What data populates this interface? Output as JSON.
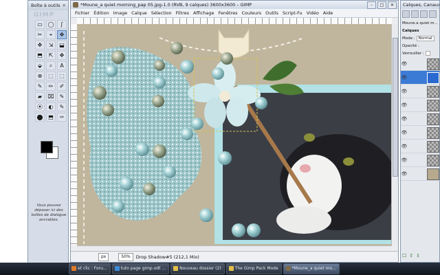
{
  "toolbox": {
    "title": "Boîte à outils",
    "close": "✕",
    "logo": "GIMP",
    "tools": [
      "▭",
      "◯",
      "ʃ",
      "✂",
      "⌖",
      "✥",
      "✥",
      "⇲",
      "⬓",
      "⬒",
      "⇱",
      "✥",
      "⬙",
      "⌕",
      "A",
      "⊕",
      "⬚",
      "⬚",
      "✎",
      "✏",
      "✐",
      "▰",
      "⌧",
      "✎",
      "⦿",
      "◐",
      "✎",
      "⬤",
      "⬒",
      "✑"
    ],
    "fg_color": "#000000",
    "bg_color": "#ffffff",
    "drop_hint": "Vous pouvez déposer ici des boîtes de dialogue ancrables."
  },
  "image_window": {
    "title": "*Moune_a quiet morning_pap 05.jpg-1.0 (RVB, 9 calques) 3600x3600 – GIMP",
    "menus": [
      "Fichier",
      "Édition",
      "Image",
      "Calque",
      "Sélection",
      "Filtres",
      "Affichage",
      "Fenêtres",
      "Couleurs",
      "Outils",
      "Script-Fu",
      "Vidéo",
      "Aide"
    ],
    "unit": "px",
    "zoom": "50%",
    "status": "Drop Shadow#5 (212,1 Mio)",
    "min": "–",
    "max": "□",
    "close": "✕"
  },
  "layers_dock": {
    "title": "Calques, Canaux, Che",
    "tab_label": "Moune.a quiet m...",
    "section": "Calques",
    "mode_label": "Mode :",
    "mode_value": "Normal",
    "opacity_label": "Opacité :",
    "lock_label": "Verrouiller :",
    "layers": [
      {
        "visible": "👁",
        "selected": false,
        "kind": "check"
      },
      {
        "visible": "👁",
        "selected": true,
        "kind": "selected"
      },
      {
        "visible": "👁",
        "selected": false,
        "kind": "check"
      },
      {
        "visible": "👁",
        "selected": false,
        "kind": "check"
      },
      {
        "visible": "👁",
        "selected": false,
        "kind": "check"
      },
      {
        "visible": "👁",
        "selected": false,
        "kind": "check"
      },
      {
        "visible": "👁",
        "selected": false,
        "kind": "check"
      },
      {
        "visible": "👁",
        "selected": false,
        "kind": "check"
      },
      {
        "visible": "👁",
        "selected": false,
        "kind": "paper"
      }
    ],
    "bottom_icons": [
      "☐",
      "⇧",
      "⇩"
    ]
  },
  "taskbar": [
    {
      "label": "et clic : Foru...",
      "color": "#e07b2a"
    },
    {
      "label": "tuto page gimp.odt ...",
      "color": "#3c8ad8"
    },
    {
      "label": "Nouveau dossier (2)",
      "color": "#e0c04a"
    },
    {
      "label": "The Gimp Pack Mode",
      "color": "#e0c04a"
    },
    {
      "label": "*Moune_a quiet mo...",
      "color": "#7d6a4a",
      "active": true
    }
  ],
  "colors": {
    "paper": "#b7ac92",
    "frame": "#a9d9df",
    "beads": "#8fc6cc"
  }
}
